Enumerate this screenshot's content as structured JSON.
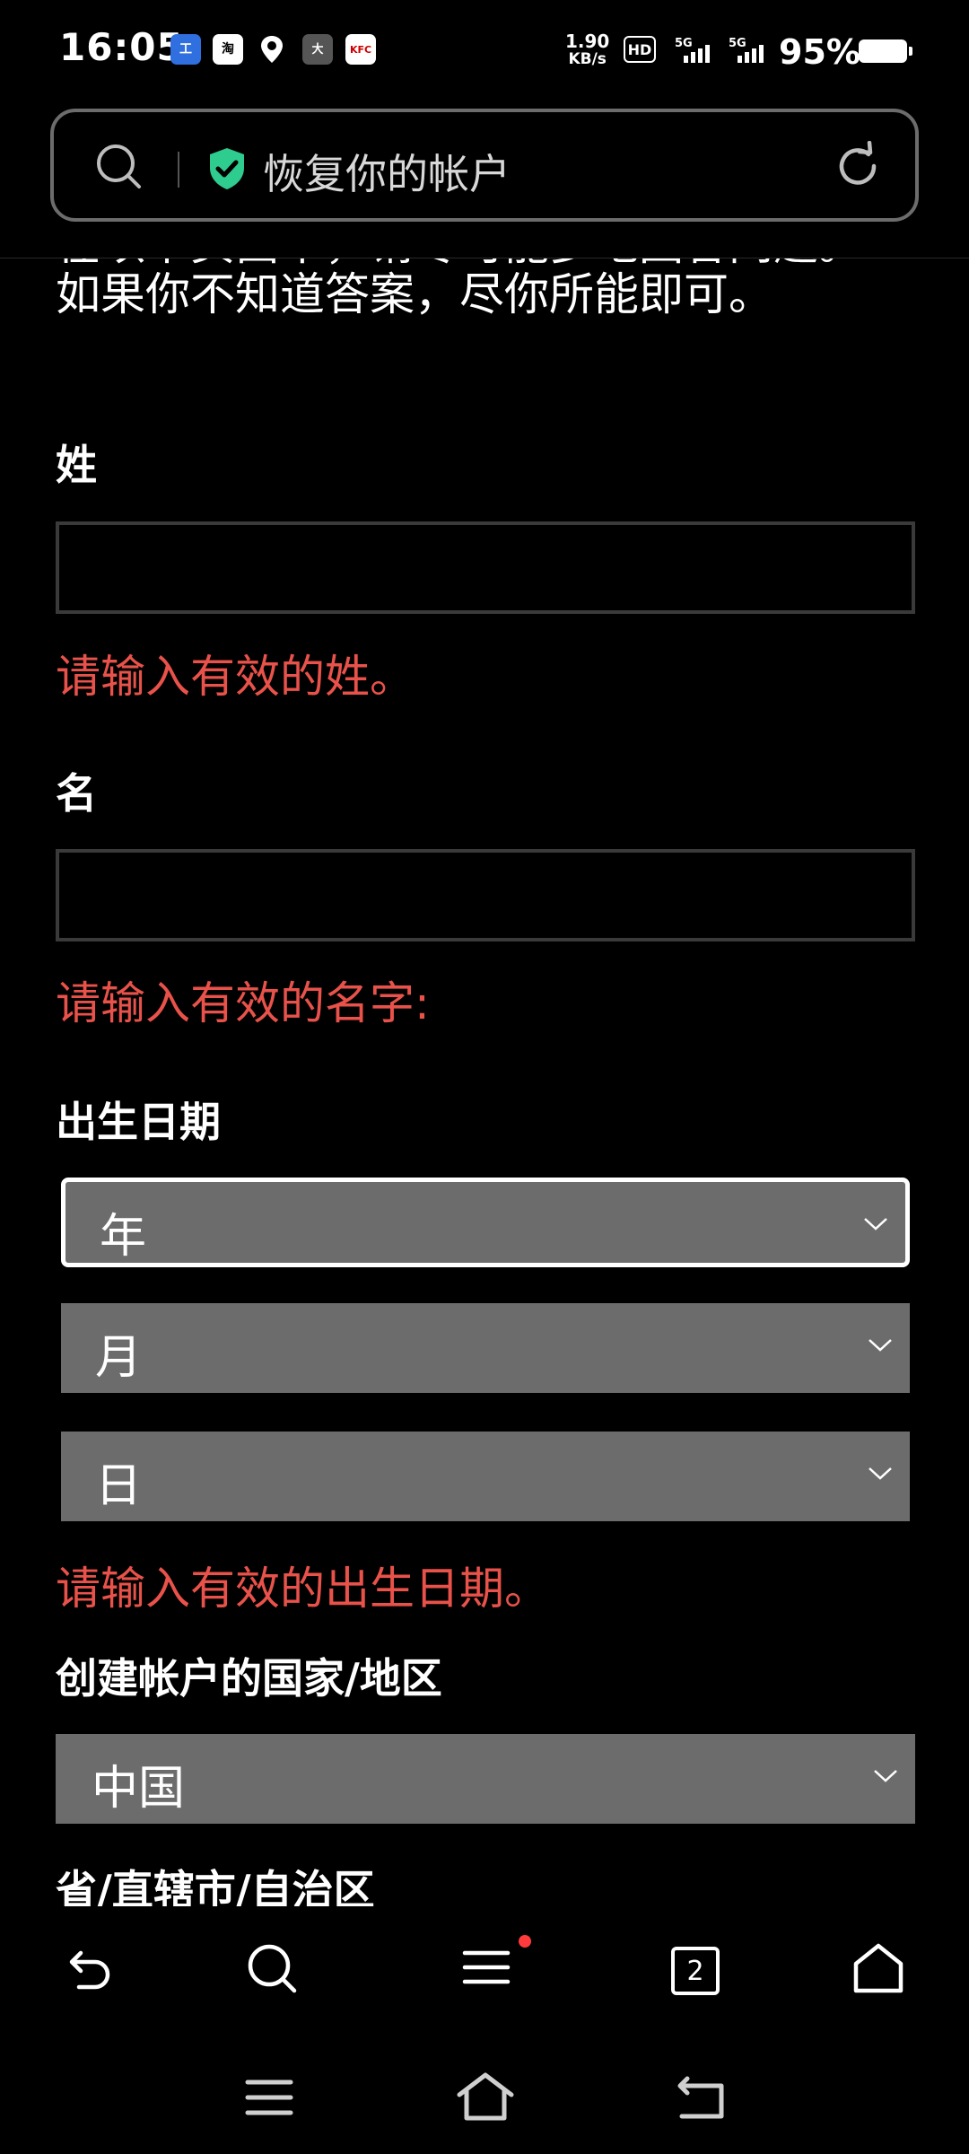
{
  "status_bar": {
    "time": "16:05",
    "net_speed_value": "1.90",
    "net_speed_unit": "KB/s",
    "hd_label": "HD",
    "battery": "95%",
    "app_icons": [
      "工",
      "淘",
      "du",
      "大",
      "KFC"
    ]
  },
  "address_bar": {
    "title": "恢复你的帐户"
  },
  "form": {
    "intro": "在以下页面中，请尽可能多地回答问题。如果你不知道答案，尽你所能即可。",
    "last_name_label": "姓",
    "last_name_value": "",
    "last_name_error": "请输入有效的姓。",
    "first_name_label": "名",
    "first_name_value": "",
    "first_name_error": "请输入有效的名字:",
    "dob_label": "出生日期",
    "year_select": "年",
    "month_select": "月",
    "day_select": "日",
    "dob_error": "请输入有效的出生日期。",
    "country_label": "创建帐户的国家/地区",
    "country_select": "中国",
    "province_label": "省/直辖市/自治区"
  },
  "toolbar": {
    "tab_count": "2"
  },
  "colors": {
    "error": "#e8524a",
    "select_bg": "#6c6c6c",
    "shield": "#2ecc8f",
    "notification_dot": "#ff3b3b"
  }
}
